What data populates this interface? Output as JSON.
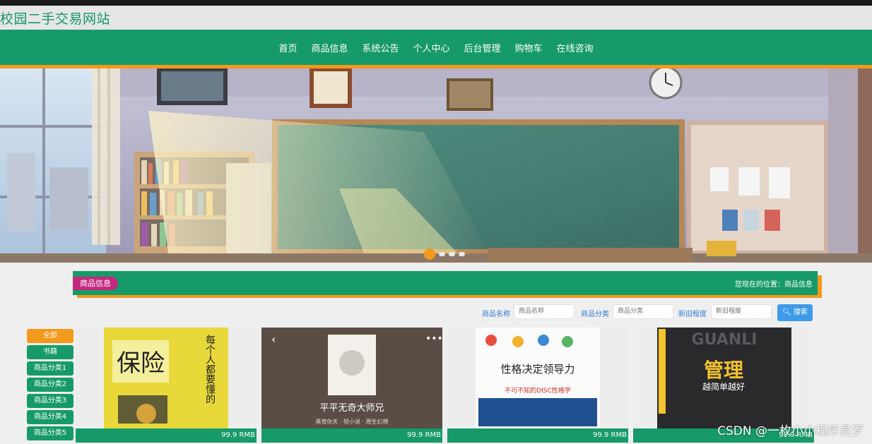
{
  "site": {
    "title": "校园二手交易网站"
  },
  "nav": {
    "items": [
      "首页",
      "商品信息",
      "系统公告",
      "个人中心",
      "后台管理",
      "购物车",
      "在线咨询"
    ]
  },
  "colors": {
    "primary": "#169a69",
    "accent": "#f39a1d",
    "pill": "#c3297d",
    "search_button": "#3d9be9"
  },
  "section": {
    "title": "商品信息",
    "breadcrumb": "您现在的位置：商品信息"
  },
  "search": {
    "fields": [
      {
        "label": "商品名称",
        "placeholder": "商品名称"
      },
      {
        "label": "商品分类",
        "placeholder": "商品分类"
      },
      {
        "label": "新旧程度",
        "placeholder": "新旧程度"
      }
    ],
    "button": "搜索",
    "button_icon": "search-icon"
  },
  "categories": [
    "全部",
    "书籍",
    "商品分类1",
    "商品分类2",
    "商品分类3",
    "商品分类4",
    "商品分类5"
  ],
  "products": [
    {
      "price": "99.9 RMB",
      "cover": {
        "big": "保险",
        "title": "每个人都要懂的"
      }
    },
    {
      "price": "99.9 RMB",
      "cover": {
        "big": "平平无奇大师兄",
        "sub": "黑夜你天 · 轻小说 · 原生幻想"
      }
    },
    {
      "price": "99.9 RMB",
      "cover": {
        "big": "性格决定领导力",
        "sub": "不可不知的DISC性格学"
      }
    },
    {
      "price": "99.9 RMB",
      "cover": {
        "big": "管理",
        "sub": "越简单越好",
        "top": "GUANLI"
      }
    }
  ],
  "watermark": "CSDN @一枚小小程序员罗"
}
